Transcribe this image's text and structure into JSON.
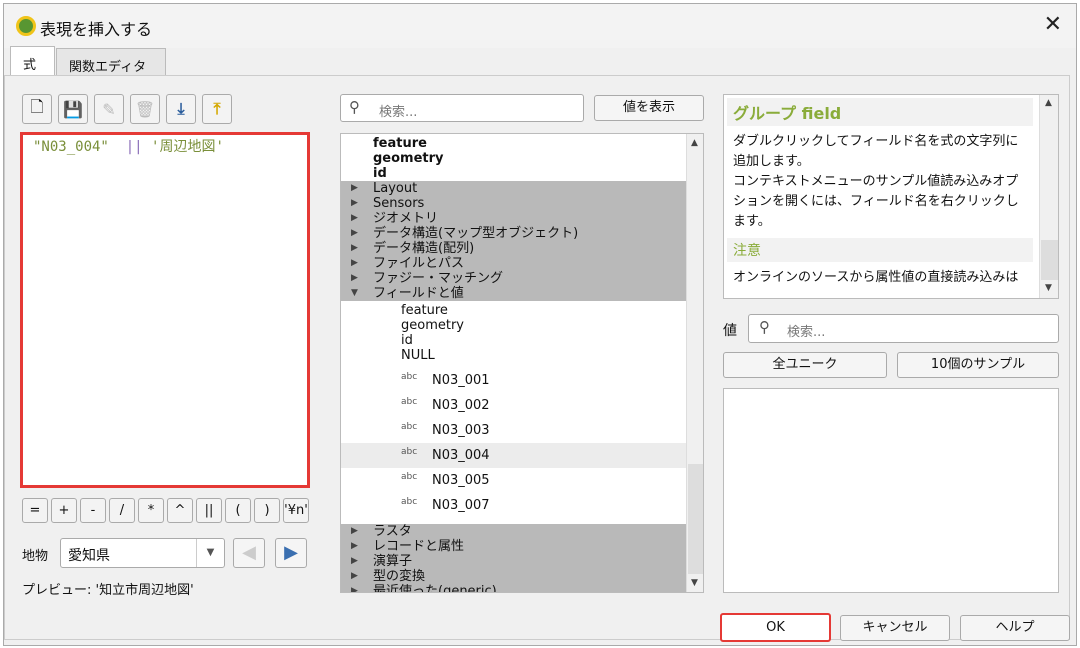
{
  "window": {
    "title": "表現を挿入する",
    "close": "✕"
  },
  "tabs": [
    {
      "label": "式"
    },
    {
      "label": "関数エディタ"
    }
  ],
  "toolbar": {
    "icons": [
      "new-file-icon",
      "save-icon",
      "edit-icon",
      "delete-icon",
      "import-icon",
      "export-icon"
    ]
  },
  "editor": {
    "field": "\"N03_004\"",
    "operator": "||",
    "string": "'周辺地図'"
  },
  "operators": [
    "=",
    "+",
    "-",
    "/",
    "*",
    "^",
    "||",
    "(",
    ")",
    "'¥n'"
  ],
  "feature": {
    "label": "地物",
    "value": "愛知県"
  },
  "preview": {
    "label": "プレビュー:",
    "value": "'知立市周辺地図'"
  },
  "search": {
    "placeholder": "検索...",
    "show_values": "値を表示"
  },
  "tree": {
    "top": [
      "feature",
      "geometry",
      "id"
    ],
    "groups_before": [
      "Layout",
      "Sensors",
      "ジオメトリ",
      "データ構造(マップ型オブジェクト)",
      "データ構造(配列)",
      "ファイルとパス",
      "ファジー・マッチング"
    ],
    "expanded": "フィールドと値",
    "children": [
      "feature",
      "geometry",
      "id",
      "NULL"
    ],
    "fields": [
      {
        "type": "abc",
        "name": "N03_001"
      },
      {
        "type": "abc",
        "name": "N03_002"
      },
      {
        "type": "abc",
        "name": "N03_003"
      },
      {
        "type": "abc",
        "name": "N03_004"
      },
      {
        "type": "abc",
        "name": "N03_005"
      },
      {
        "type": "abc",
        "name": "N03_007"
      }
    ],
    "groups_after": [
      "ラスタ",
      "レコードと属性",
      "演算子",
      "型の変換",
      "最近使った(generic)"
    ]
  },
  "help": {
    "title": "グループ field",
    "p1": "ダブルクリックしてフィールド名を式の文字列に追加します。",
    "p2": "コンテキストメニューのサンプル値読み込みオプションを開くには、フィールド名を右クリックします。",
    "note_title": "注意",
    "note": "オンラインのソースから属性値の直接読み込みは"
  },
  "values": {
    "label": "値",
    "placeholder": "検索...",
    "all_unique": "全ユニーク",
    "sample": "10個のサンプル"
  },
  "buttons": {
    "ok": "OK",
    "cancel": "キャンセル",
    "help": "ヘルプ"
  }
}
